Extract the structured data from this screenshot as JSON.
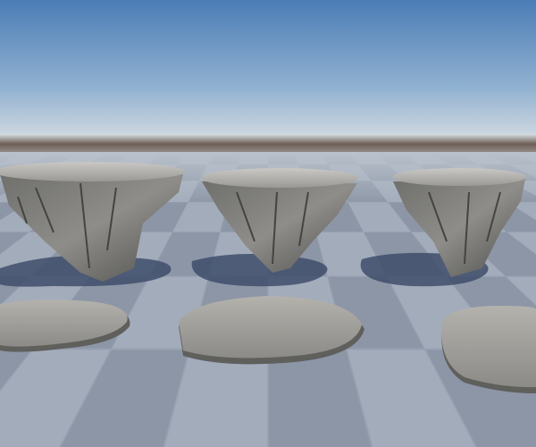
{
  "scene": {
    "colors": {
      "sky_top": "#4c7db6",
      "sky_horizon": "#d6dde2",
      "ground_band": "#6e5f56",
      "floor_light": "#a3acbb",
      "floor_dark": "#8d96a6",
      "rock": "#8a8a86",
      "shadow": "#3f4e6b"
    }
  }
}
